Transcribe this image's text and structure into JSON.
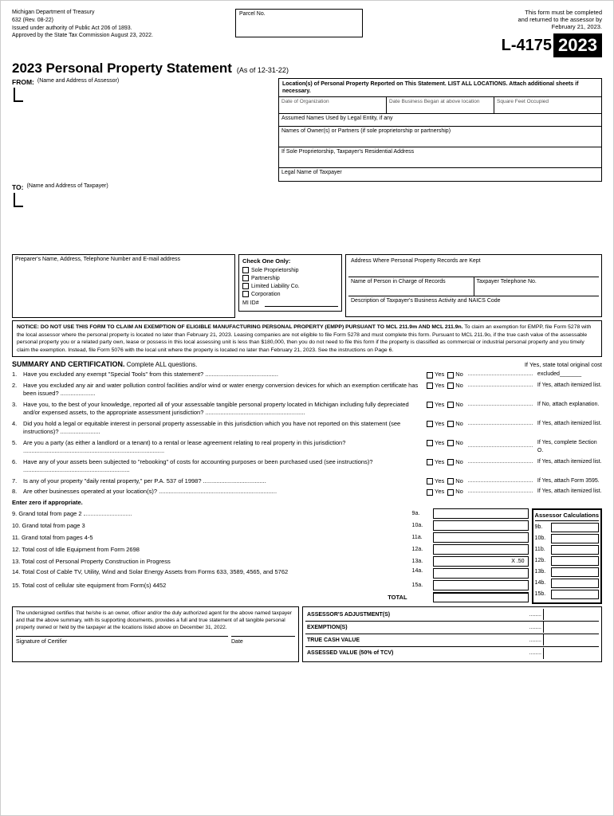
{
  "header": {
    "dept": "Michigan Department of Treasury",
    "form_num": "632  (Rev. 08-22)",
    "authority": "Issued under authority of Public Act 206 of 1893.",
    "approved": "Approved by the State Tax Commission August 23, 2022.",
    "parcel_label": "Parcel No.",
    "notice_right_1": "This form must be completed",
    "notice_right_2": "and returned to the assessor by",
    "notice_right_3": "February 21, 2023.",
    "l_number": "L-4175",
    "year": "2023"
  },
  "title": {
    "main": "2023 Personal Property Statement",
    "sub": "(As of 12-31-22)"
  },
  "from": {
    "label": "FROM:",
    "sublabel": "(Name and Address of Assessor)"
  },
  "to": {
    "label": "TO:",
    "sublabel": "(Name and Address of Taxpayer)"
  },
  "right_col": {
    "header": "Location(s) of Personal Property Reported on This Statement. LIST ALL LOCATIONS. Attach additional sheets if necessary.",
    "row1": {
      "col1_label": "Date of Organization",
      "col2_label": "Date Business Began at above location",
      "col3_label": "Square Feet Occupied"
    },
    "assumed_names_label": "Assumed Names Used by Legal Entity, if any",
    "owners_label": "Names of Owner(s) or Partners (if sole proprietorship or partnership)",
    "sole_prop_label": "If Sole Proprietorship, Taxpayer's Residential Address",
    "legal_name_label": "Legal Name of Taxpayer"
  },
  "preparer": {
    "label": "Preparer's Name, Address, Telephone Number and E-mail address"
  },
  "check_one": {
    "title": "Check One Only:",
    "options": [
      "Sole Proprietorship",
      "Partnership",
      "Limited Liability Co.",
      "Corporation",
      "MI ID#"
    ]
  },
  "address_records": {
    "label": "Address Where Personal Property Records are Kept",
    "row1_col1_label": "Name of Person in Charge of Records",
    "row1_col2_label": "Taxpayer Telephone No.",
    "row2_label": "Description of Taxpayer's Business Activity and NAICS Code"
  },
  "notice": {
    "bold_text": "NOTICE: DO NOT USE THIS FORM TO CLAIM AN EXEMPTION OF ELIGIBLE MANUFACTURING PERSONAL PROPERTY (EMPP) PURSUANT TO MCL 211.9m AND MCL 211.9n.",
    "body": " To claim an exemption for EMPP, file Form 5278 with the local assessor where the personal property is located no later than February 21, 2023. Leasing companies are not eligible to file Form 5278 and must complete this form. Pursuant to MCL 211.9o, if the true cash value of the assessable personal property you or a related party own, lease or possess in this local assessing unit is less than $180,000, then you do not need to file this form if the property is classified as commercial or industrial personal property and you timely claim the exemption. Instead, file Form 5076 with the local unit where the property is located no later than February 21, 2023. See the instructions on Page 6."
  },
  "summary": {
    "title": "SUMMARY AND CERTIFICATION.",
    "complete_all": "Complete ALL questions.",
    "right_note": "If Yes, state total original cost",
    "questions": [
      {
        "num": "1.",
        "text": "Have you excluded any exempt \"Special Tools\" from this statement? ............................................",
        "yn_note": "excluded_______"
      },
      {
        "num": "2.",
        "text": "Have you excluded any air and water pollution control facilities and/or wind or water energy conversion devices for which an exemption certificate has been issued? .....................",
        "yn_note": "If Yes, attach itemized list."
      },
      {
        "num": "3.",
        "text": "Have you, to the best of your knowledge, reported all of your assessable tangible personal property located in Michigan including fully depreciated and/or expensed assets, to the appropriate assessment jurisdiction? ............................................................",
        "yn_note": "If No, attach explanation."
      },
      {
        "num": "4.",
        "text": "Did you hold a legal or equitable interest in personal property assessable in this jurisdiction which you have not reported on this statement (see instructions)? ........................",
        "yn_note": "If Yes, attach itemized list."
      },
      {
        "num": "5.",
        "text": "Are you a party (as either a landlord or a tenant) to a rental or lease agreement relating to real property in this jurisdiction? .....................................................................................",
        "yn_note": "If Yes, complete Section O."
      },
      {
        "num": "6.",
        "text": "Have any of your assets been subjected to \"rebooking\" of costs for accounting purposes or been purchased used (see instructions)? ................................................................",
        "yn_note": "If Yes, attach itemized list."
      },
      {
        "num": "7.",
        "text": "Is any of your property \"daily rental property,\" per P.A. 537 of 1998? ......................................",
        "yn_note": "If Yes, attach Form 3595."
      },
      {
        "num": "8.",
        "text": "Are other businesses operated at your location(s)? .......................................................................",
        "yn_note": "If Yes, attach itemized list."
      }
    ]
  },
  "enter_zero": "Enter zero if appropriate.",
  "totals": [
    {
      "num": "9.",
      "label": "Grand total from page 2",
      "id": "9a.",
      "assessor_id": "9b."
    },
    {
      "num": "10.",
      "label": "Grand total from page 3",
      "id": "10a.",
      "assessor_id": "10b."
    },
    {
      "num": "11.",
      "label": "Grand total from pages 4-5",
      "id": "11a.",
      "assessor_id": "11b."
    },
    {
      "num": "12.",
      "label": "Total cost of Idle Equipment from Form 2698",
      "id": "12a.",
      "assessor_id": "12b."
    },
    {
      "num": "13.",
      "label": "Total cost of Personal Property Construction in Progress",
      "id": "13a.",
      "x50": "X .50",
      "assessor_id": "13b."
    },
    {
      "num": "14.",
      "label": "Total Cost of Cable TV, Utility, Wind and Solar Energy Assets from Forms 633, 3589, 4565, and 5762",
      "id": "14a.",
      "assessor_id": "14b."
    },
    {
      "num": "15.",
      "label": "Total cost of cellular site equipment from Form(s) 4452",
      "id": "15a.",
      "assessor_id": "15b."
    },
    {
      "num": "",
      "label": "TOTAL",
      "id": "",
      "assessor_id": "",
      "is_total": true
    }
  ],
  "assessor_calc": {
    "title": "Assessor Calculations"
  },
  "certification": {
    "text": "The undersigned certifies that he/she is an owner, officer and/or the duly authorized agent for the above named taxpayer and that the above summary, with its supporting documents, provides a full and true statement of all tangible personal property owned or held by the taxpayer at the locations listed above on December 31, 2022.",
    "sig_label": "Signature of Certifier",
    "date_label": "Date"
  },
  "adjustments": {
    "rows": [
      {
        "label": "ASSESSOR'S ADJUSTMENT(S)",
        "value": "........"
      },
      {
        "label": "EXEMPTION(S)",
        "value": "........"
      },
      {
        "label": "TRUE CASH VALUE",
        "value": "........"
      },
      {
        "label": "ASSESSED VALUE (50% of TCV)",
        "value": "........"
      }
    ]
  }
}
